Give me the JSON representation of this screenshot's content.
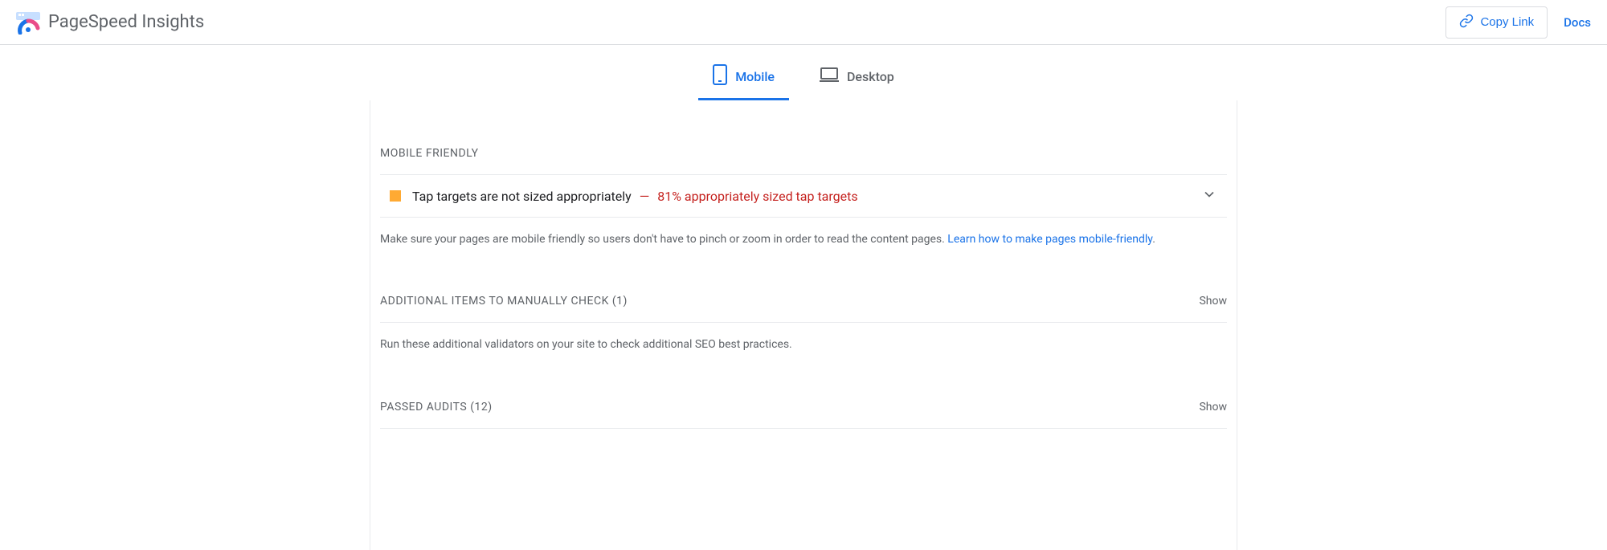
{
  "header": {
    "title": "PageSpeed Insights",
    "copy_link_label": "Copy Link",
    "docs_label": "Docs"
  },
  "tabs": {
    "mobile_label": "Mobile",
    "desktop_label": "Desktop"
  },
  "sections": {
    "mobile_friendly": {
      "title": "Mobile Friendly",
      "audit": {
        "title": "Tap targets are not sized appropriately",
        "dash": "—",
        "detail": "81% appropriately sized tap targets"
      },
      "description_prefix": "Make sure your pages are mobile friendly so users don't have to pinch or zoom in order to read the content pages. ",
      "description_link": "Learn how to make pages mobile-friendly",
      "description_suffix": "."
    },
    "additional": {
      "title": "Additional items to manually check",
      "count": " (1)",
      "show_label": "Show",
      "description": "Run these additional validators on your site to check additional SEO best practices."
    },
    "passed": {
      "title": "Passed audits",
      "count": " (12)",
      "show_label": "Show"
    }
  }
}
